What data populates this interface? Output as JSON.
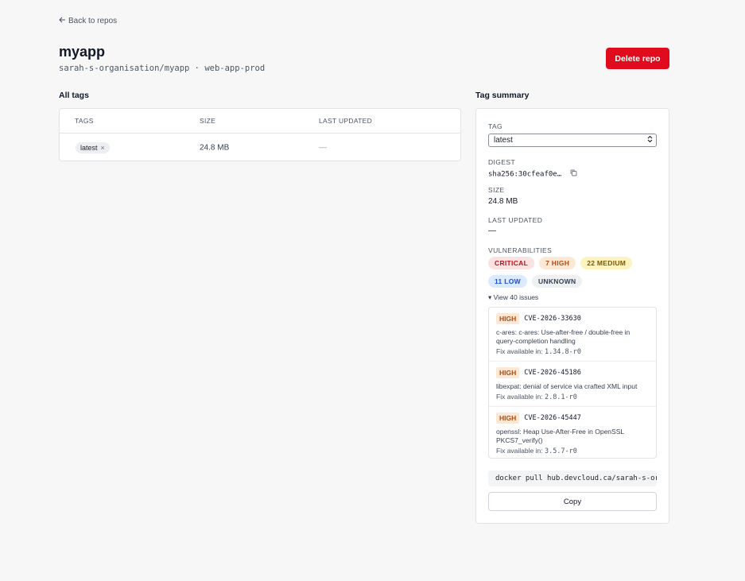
{
  "header": {
    "back_label": "Back to repos",
    "title": "myapp",
    "subtitle": "sarah-s-organisation/myapp · web-app-prod",
    "delete_label": "Delete repo"
  },
  "all_tags": {
    "heading": "All tags",
    "columns": [
      "TAGS",
      "SIZE",
      "LAST UPDATED"
    ],
    "rows": [
      {
        "tag": "latest",
        "remove": "×",
        "size": "24.8 MB",
        "updated": "—"
      }
    ]
  },
  "summary": {
    "heading": "Tag summary",
    "tag_label": "TAG",
    "tag_selected": "latest",
    "digest_label": "DIGEST",
    "digest": "sha256:30cfeaf0e…",
    "size_label": "SIZE",
    "size": "24.8 MB",
    "updated_label": "LAST UPDATED",
    "updated": "—",
    "vuln_label": "VULNERABILITIES",
    "badges": {
      "critical": "CRITICAL",
      "high": "7 HIGH",
      "medium": "22 MEDIUM",
      "low": "11 LOW",
      "unknown": "UNKNOWN"
    },
    "view_issues": "▾ View 40 issues",
    "fix_prefix": "Fix available in: ",
    "issues": [
      {
        "severity": "HIGH",
        "id": "CVE-2026-33630",
        "desc": "c-ares: c-ares: Use-after-free / double-free in query-completion handling",
        "fix": "1.34.8-r0"
      },
      {
        "severity": "HIGH",
        "id": "CVE-2026-45186",
        "desc": "libexpat: denial of service via crafted XML input",
        "fix": "2.8.1-r0"
      },
      {
        "severity": "HIGH",
        "id": "CVE-2026-45447",
        "desc": "openssl: Heap Use-After-Free in OpenSSL PKCS7_verify()",
        "fix": "3.5.7-r0"
      }
    ],
    "docker_cmd": "docker pull hub.devcloud.ca/sarah-s-organisation/myapp:latest",
    "copy_label": "Copy"
  },
  "colors": {
    "delete": "#e00b1c",
    "critical": "#b3141f",
    "high": "#b04a10",
    "medium": "#7a5a00",
    "low": "#1d4ed8"
  }
}
